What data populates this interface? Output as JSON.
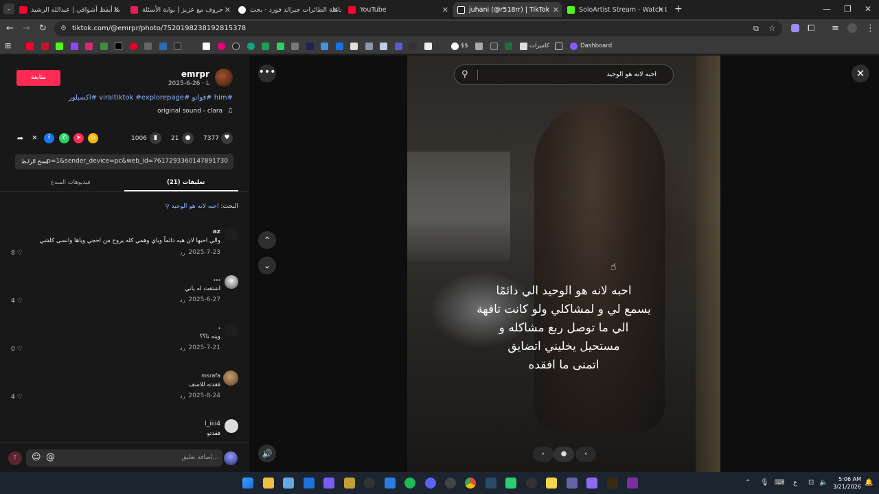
{
  "browser": {
    "tabs": [
      {
        "title": "ما أبقظ أشواقي | عبدالله الرشيد",
        "color": "#ff0033"
      },
      {
        "title": "حروف مع عزيز | بوابة الأسئلة",
        "color": "#e81c5a"
      },
      {
        "title": "حاملة الطائرات جيرالد فورد - بحث",
        "color": "#ffffff"
      },
      {
        "title": "YouTube",
        "color": "#ff0033"
      },
      {
        "title": "juhani (@r518rr) | TikTok",
        "color": "#ffffff"
      },
      {
        "title": "SoloArtist Stream - Watch Live",
        "color": "#53fc18"
      }
    ],
    "new_tab": "+",
    "url": "tiktok.com/@emrpr/photo/7520198238192815378",
    "bookmarks": {
      "folder_cameras": "كاميرات",
      "dashboard": "Dashboard",
      "dollar": "$$"
    }
  },
  "post": {
    "follow_button": "متابعة",
    "username": "emrpr",
    "date": "2025-6-26 · L",
    "caption": "#him #قوانو #viraltiktok #explorepage #اكسبلور",
    "sound": "original sound - clara",
    "stats": {
      "likes": "7377",
      "comments": "21",
      "saves": "1006"
    },
    "copy_link": "نسخ الرابط",
    "link_text": "...p=1&sender_device=pc&web_id=7617293360147891730",
    "tabs": {
      "comments": "تعليقات (21)",
      "creator_videos": "فيديوهات المبدع"
    },
    "search_prefix": "البحث:",
    "search_query": "احبه لانه هو الوحيد"
  },
  "comments": [
    {
      "name": "az",
      "text": "والي احبها لان هيه دائماً وياي وهمي كله يروح من احجي وياها وانسى كلشي",
      "date": "2025-7-23",
      "reply": "رد",
      "likes": "8"
    },
    {
      "name": "...",
      "text": "اشتقت له ياني",
      "date": "2025-6-27",
      "reply": "رد",
      "likes": "4"
    },
    {
      "name": ".",
      "text": "وينه نا؟؟",
      "date": "2025-7-21",
      "reply": "رد",
      "likes": "0"
    },
    {
      "name": "msrafa",
      "text": "فقدته للاسف",
      "date": "2025-8-24",
      "reply": "رد",
      "likes": "4"
    },
    {
      "name": "l_iiii4",
      "text": "فقدتو",
      "date": "",
      "reply": "",
      "likes": ""
    }
  ],
  "comment_box": {
    "placeholder": "إضافة تعليق...",
    "at": "@"
  },
  "viewer": {
    "search_query": "احبه لانه هو الوحيد",
    "overlay_lines": [
      "احبه لانه هو الوحيد الي دائمًا",
      "يسمع لي و لمشاكلي ولو كانت تافهة",
      "الي ما توصل ربع مشاكله و",
      "مستحيل يخليني اتضايق",
      "اتمنى ما افقده"
    ]
  },
  "taskbar": {
    "lang": "ع",
    "time": "5:06 AM",
    "date": "3/21/2026"
  },
  "colors": {
    "accent": "#fe2c55",
    "link": "#8ab4f8"
  }
}
